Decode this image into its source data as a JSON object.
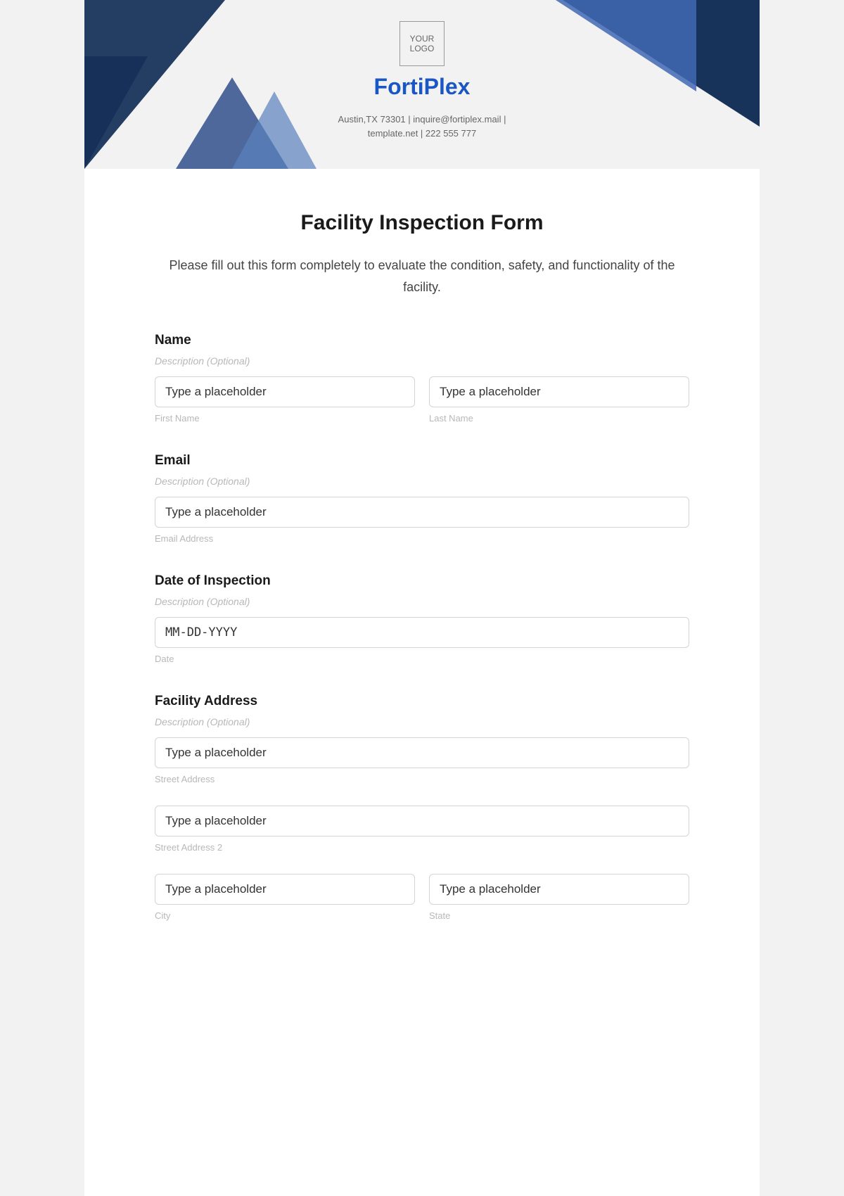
{
  "header": {
    "logo_text": "YOUR\nLOGO",
    "brand": "FortiPlex",
    "contact_line1": "Austin,TX 73301 | inquire@fortiplex.mail |",
    "contact_line2": "template.net | 222 555 777"
  },
  "form": {
    "title": "Facility Inspection Form",
    "intro": "Please fill out this form completely to evaluate the condition, safety, and functionality of the facility.",
    "desc_optional": "Description (Optional)",
    "placeholder": "Type a placeholder",
    "name": {
      "label": "Name",
      "first_sub": "First Name",
      "last_sub": "Last Name"
    },
    "email": {
      "label": "Email",
      "sub": "Email Address"
    },
    "date": {
      "label": "Date of Inspection",
      "placeholder": "MM-DD-YYYY",
      "sub": "Date"
    },
    "address": {
      "label": "Facility Address",
      "street_sub": "Street Address",
      "street2_sub": "Street Address 2",
      "city_sub": "City",
      "state_sub": "State"
    }
  }
}
